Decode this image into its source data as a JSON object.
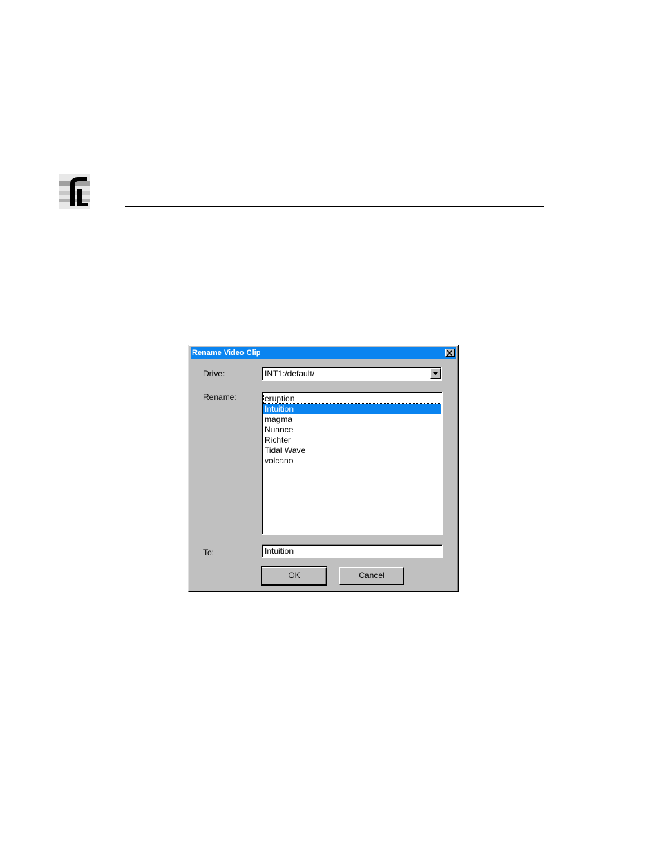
{
  "dialog": {
    "title": "Rename Video Clip",
    "drive_label": "Drive:",
    "drive_value": "INT1:/default/",
    "rename_label": "Rename:",
    "clips": [
      "eruption",
      "Intuition",
      "magma",
      "Nuance",
      "Richter",
      "Tidal Wave",
      "volcano"
    ],
    "selected_clip": "Intuition",
    "to_label": "To:",
    "to_value": "Intuition",
    "ok_label": "OK",
    "cancel_label": "Cancel"
  },
  "colors": {
    "titlebar": "#0a84f0",
    "selection": "#0a84f0",
    "dialog_face": "#c0c0c0"
  },
  "icons": {
    "logo": "pvs-logo",
    "close": "close-icon",
    "dropdown": "chevron-down-icon"
  }
}
